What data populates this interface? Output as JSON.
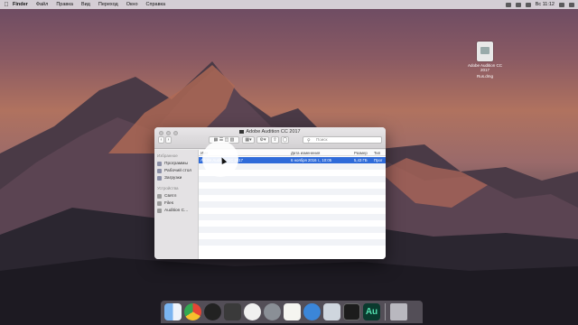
{
  "menubar": {
    "apple_icon": "apple-icon",
    "app_name": "Finder",
    "items": [
      "Файл",
      "Правка",
      "Вид",
      "Переход",
      "Окно",
      "Справка"
    ],
    "clock": "Вс 11:12"
  },
  "desktop_file": {
    "label_line1": "Adobe Audition CC 2017",
    "label_line2": "Rus.dmg"
  },
  "finder": {
    "title": "Adobe Audition CC 2017",
    "search_placeholder": "Поиск",
    "sidebar": {
      "favorites_header": "Избранное",
      "favorites": [
        "Программы",
        "Рабочий стол",
        "Загрузки"
      ],
      "devices_header": "Устройства",
      "devices": [
        "Святл",
        "Files",
        "Audition C..."
      ]
    },
    "columns": {
      "name": "Имя",
      "date": "Дата изменения",
      "size": "Размер",
      "kind": "Тип"
    },
    "rows": [
      {
        "name": "Adobe Audition CC 2017",
        "date": "6 ноября 2016 г., 10:05",
        "size": "5,43 ГБ",
        "kind": "Прог"
      }
    ]
  },
  "dock": {
    "icons": [
      "finder-icon",
      "chrome-icon",
      "mouse-icon",
      "robot-icon",
      "itunes-icon",
      "settings-icon",
      "notes-icon",
      "safari-icon",
      "preview-icon",
      "terminal-icon",
      "audition-icon",
      "trash-icon"
    ],
    "audition_label": "Au"
  }
}
